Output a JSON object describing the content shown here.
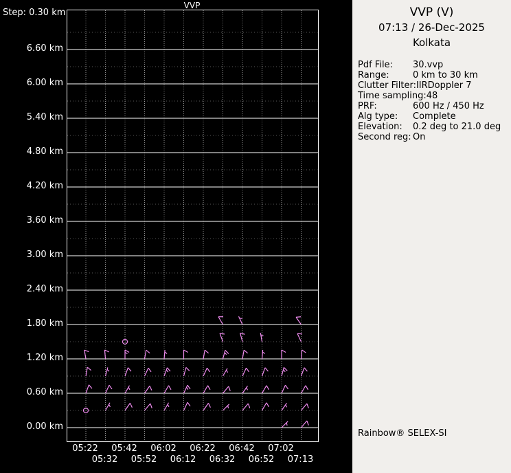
{
  "chart": {
    "title": "VVP",
    "step_label": "Step: 0.30 km",
    "y_ticks": [
      "6.60 km",
      "6.00 km",
      "5.40 km",
      "4.80 km",
      "4.20 km",
      "3.60 km",
      "3.00 km",
      "2.40 km",
      "1.80 km",
      "1.20 km",
      "0.60 km",
      "0.00 km"
    ],
    "x_ticks_row1": [
      "05:22",
      "05:42",
      "06:02",
      "06:22",
      "06:42",
      "07:02"
    ],
    "x_ticks_row2": [
      "05:32",
      "05:52",
      "06:12",
      "06:32",
      "06:52",
      "07:13"
    ]
  },
  "panel": {
    "title": "VVP (V)",
    "datetime": "07:13 / 26-Dec-2025",
    "site": "Kolkata",
    "fields": [
      {
        "label": "Pdf File:",
        "value": "30.vvp"
      },
      {
        "label": "Range:",
        "value": "0 km to 30 km"
      },
      {
        "label": "Clutter Filter:",
        "value": "IIRDoppler 7"
      },
      {
        "label": "Time sampling:",
        "value": "48"
      },
      {
        "label": "PRF:",
        "value": "600 Hz / 450 Hz"
      },
      {
        "label": "Alg type:",
        "value": "Complete"
      },
      {
        "label": "Elevation:",
        "value": "0.2 deg to 21.0 deg"
      },
      {
        "label": "Second reg:",
        "value": "On"
      }
    ],
    "brand": "Rainbow® SELEX-SI"
  },
  "chart_data": {
    "type": "wind-barb-profile",
    "title": "VVP",
    "times": [
      "05:22",
      "05:32",
      "05:42",
      "05:52",
      "06:02",
      "06:12",
      "06:22",
      "06:32",
      "06:42",
      "06:52",
      "07:02",
      "07:13"
    ],
    "altitude_step_km": 0.3,
    "altitude_range_km": [
      0.0,
      7.2
    ],
    "y_tick_interval_km": 0.6,
    "barb_color": "#f08cf0",
    "grid_color": "#ffffff",
    "barbs_format": "[time_index, altitude_km, wind_from_deg, speed_kt_estimated]",
    "barbs": [
      [
        1,
        0.3,
        30,
        5
      ],
      [
        2,
        0.3,
        35,
        10
      ],
      [
        3,
        0.3,
        40,
        10
      ],
      [
        4,
        0.3,
        30,
        5
      ],
      [
        5,
        0.3,
        25,
        10
      ],
      [
        6,
        0.3,
        35,
        10
      ],
      [
        7,
        0.3,
        45,
        5
      ],
      [
        8,
        0.3,
        40,
        10
      ],
      [
        9,
        0.3,
        30,
        10
      ],
      [
        10,
        0.3,
        35,
        5
      ],
      [
        11,
        0.3,
        40,
        10
      ],
      [
        0,
        0.6,
        20,
        10
      ],
      [
        1,
        0.6,
        25,
        10
      ],
      [
        2,
        0.6,
        30,
        5
      ],
      [
        3,
        0.6,
        35,
        10
      ],
      [
        4,
        0.6,
        30,
        10
      ],
      [
        5,
        0.6,
        25,
        15
      ],
      [
        6,
        0.6,
        30,
        10
      ],
      [
        7,
        0.6,
        40,
        10
      ],
      [
        8,
        0.6,
        35,
        5
      ],
      [
        9,
        0.6,
        30,
        10
      ],
      [
        10,
        0.6,
        25,
        10
      ],
      [
        11,
        0.6,
        30,
        10
      ],
      [
        0,
        0.9,
        10,
        10
      ],
      [
        1,
        0.9,
        15,
        5
      ],
      [
        2,
        0.9,
        20,
        10
      ],
      [
        3,
        0.9,
        25,
        10
      ],
      [
        4,
        0.9,
        20,
        15
      ],
      [
        5,
        0.9,
        15,
        10
      ],
      [
        6,
        0.9,
        25,
        10
      ],
      [
        7,
        0.9,
        30,
        5
      ],
      [
        8,
        0.9,
        25,
        10
      ],
      [
        9,
        0.9,
        20,
        10
      ],
      [
        10,
        0.9,
        15,
        15
      ],
      [
        11,
        0.9,
        20,
        10
      ],
      [
        0,
        1.2,
        350,
        10
      ],
      [
        1,
        1.2,
        355,
        10
      ],
      [
        2,
        1.2,
        0,
        15
      ],
      [
        3,
        1.2,
        10,
        10
      ],
      [
        4,
        1.2,
        5,
        5
      ],
      [
        5,
        1.2,
        0,
        10
      ],
      [
        6,
        1.2,
        10,
        10
      ],
      [
        7,
        1.2,
        15,
        15
      ],
      [
        8,
        1.2,
        10,
        10
      ],
      [
        9,
        1.2,
        5,
        5
      ],
      [
        10,
        1.2,
        0,
        10
      ],
      [
        11,
        1.2,
        5,
        10
      ],
      [
        7,
        1.5,
        340,
        10
      ],
      [
        8,
        1.5,
        345,
        10
      ],
      [
        9,
        1.5,
        350,
        5
      ],
      [
        11,
        1.5,
        335,
        10
      ],
      [
        7,
        1.8,
        330,
        10
      ],
      [
        8,
        1.8,
        335,
        5
      ],
      [
        11,
        1.8,
        325,
        10
      ],
      [
        10,
        0.0,
        45,
        5
      ],
      [
        11,
        0.0,
        40,
        10
      ]
    ],
    "calm_markers_format": "[time_index, altitude_km]",
    "calm_markers": [
      [
        0,
        0.3
      ],
      [
        2,
        1.5
      ]
    ]
  }
}
